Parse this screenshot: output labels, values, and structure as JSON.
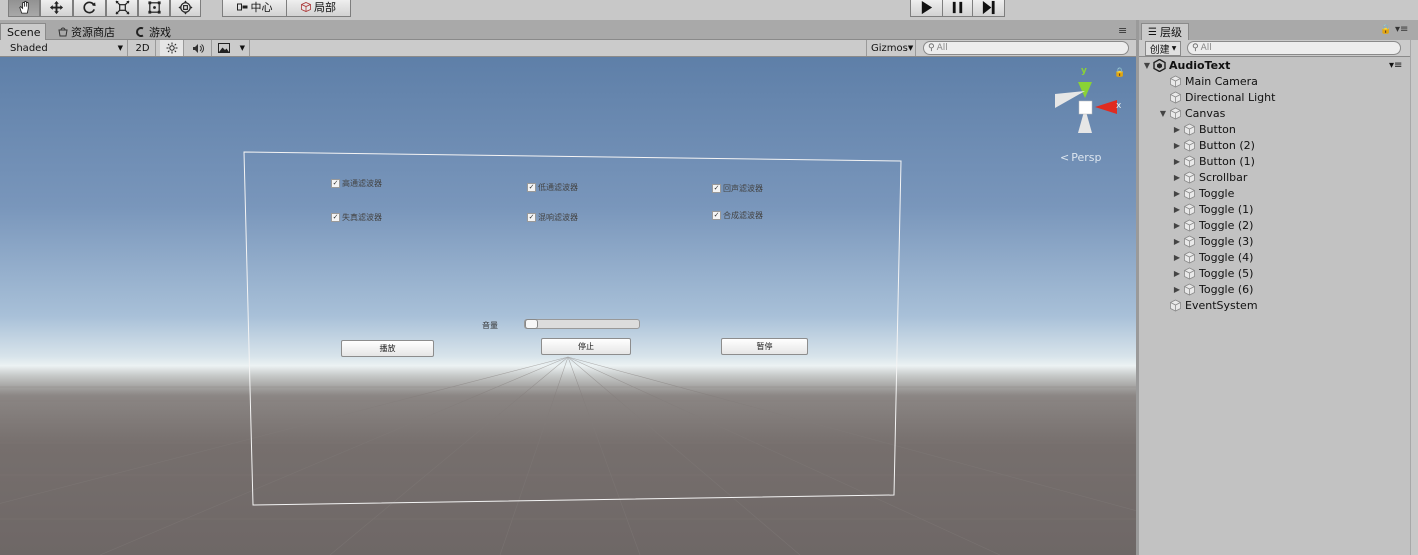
{
  "toolbar": {
    "tools": [
      "hand-tool",
      "move-tool",
      "rotate-tool",
      "scale-tool",
      "rect-tool",
      "transform-tool"
    ],
    "pivot_label": "中心",
    "space_label": "局部",
    "play_buttons": [
      "play",
      "pause",
      "step"
    ]
  },
  "tabs": {
    "scene": "Scene",
    "asset_store": "资源商店",
    "game": "游戏",
    "menu_icon": "≡"
  },
  "scene_toolbar": {
    "shading_mode": "Shaded",
    "mode_2d": "2D",
    "gizmos_label": "Gizmos",
    "search_placeholder": "All"
  },
  "scene": {
    "projection_label": "Persp",
    "axis_labels": {
      "y": "y",
      "x": "x"
    },
    "toggles": [
      {
        "label": "高通滤波器",
        "checked": true
      },
      {
        "label": "低通滤波器",
        "checked": true
      },
      {
        "label": "回声滤波器",
        "checked": true
      },
      {
        "label": "失真滤波器",
        "checked": true
      },
      {
        "label": "混响滤波器",
        "checked": true
      },
      {
        "label": "合成滤波器",
        "checked": true
      }
    ],
    "volume_label": "音量",
    "volume_value": 0,
    "buttons": [
      "播放",
      "停止",
      "暂停"
    ]
  },
  "hierarchy": {
    "tab_label": "层级",
    "create_label": "创建",
    "search_placeholder": "All",
    "scene_name": "AudioText",
    "items": [
      {
        "name": "Main Camera",
        "depth": 1,
        "expandable": false
      },
      {
        "name": "Directional Light",
        "depth": 1,
        "expandable": false
      },
      {
        "name": "Canvas",
        "depth": 1,
        "expandable": true,
        "expanded": true
      },
      {
        "name": "Button",
        "depth": 2,
        "expandable": true
      },
      {
        "name": "Button (2)",
        "depth": 2,
        "expandable": true
      },
      {
        "name": "Button (1)",
        "depth": 2,
        "expandable": true
      },
      {
        "name": "Scrollbar",
        "depth": 2,
        "expandable": true
      },
      {
        "name": "Toggle",
        "depth": 2,
        "expandable": true
      },
      {
        "name": "Toggle (1)",
        "depth": 2,
        "expandable": true
      },
      {
        "name": "Toggle (2)",
        "depth": 2,
        "expandable": true
      },
      {
        "name": "Toggle (3)",
        "depth": 2,
        "expandable": true
      },
      {
        "name": "Toggle (4)",
        "depth": 2,
        "expandable": true
      },
      {
        "name": "Toggle (5)",
        "depth": 2,
        "expandable": true
      },
      {
        "name": "Toggle (6)",
        "depth": 2,
        "expandable": true
      },
      {
        "name": "EventSystem",
        "depth": 1,
        "expandable": false
      }
    ]
  }
}
